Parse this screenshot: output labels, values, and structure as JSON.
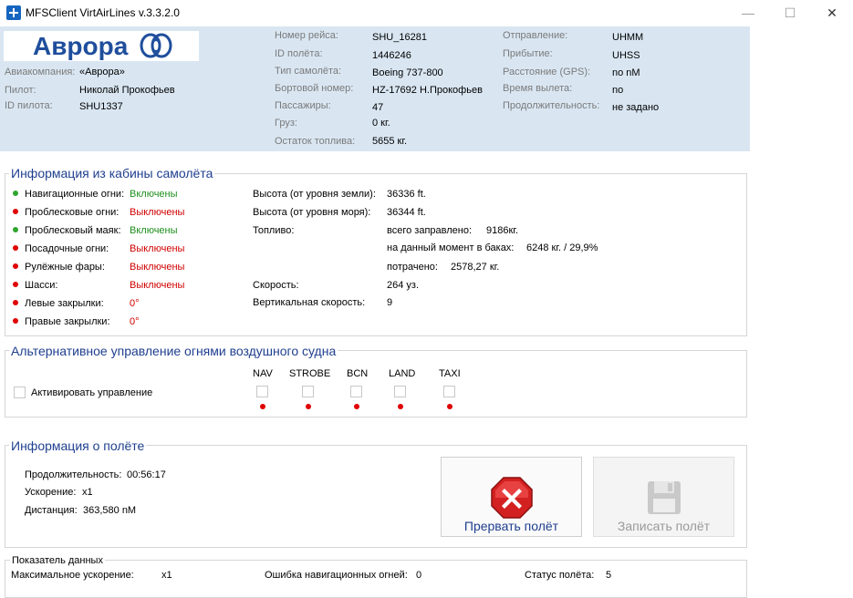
{
  "window": {
    "title": "MFSClient VirtAirLines v.3.3.2.0",
    "minimize_glyph": "—",
    "maximize_glyph": "☐",
    "close_glyph": "✕",
    "icon": "airplane-app-icon"
  },
  "header": {
    "logo_text": "Аврора",
    "left": [
      {
        "label": "Авиакомпания:",
        "value": "«Аврора»"
      },
      {
        "label": "Пилот:",
        "value": "Николай Прокофьев"
      },
      {
        "label": "ID пилота:",
        "value": "SHU1337"
      }
    ],
    "middle": [
      {
        "label": "Номер рейса:",
        "value": "SHU_16281"
      },
      {
        "label": "ID полёта:",
        "value": "1446246"
      },
      {
        "label": "Тип самолёта:",
        "value": "Boeing 737-800"
      },
      {
        "label": "Бортовой номер:",
        "value": "HZ-17692 Н.Прокофьев"
      },
      {
        "label": "Пассажиры:",
        "value": "47"
      },
      {
        "label": "Груз:",
        "value": "0 кг."
      },
      {
        "label": "Остаток топлива:",
        "value": "5655 кг."
      }
    ],
    "right": [
      {
        "label": "Отправление:",
        "value": "UHMM"
      },
      {
        "label": "Прибытие:",
        "value": "UHSS"
      },
      {
        "label": "Расстояние (GPS):",
        "value": "no nM"
      },
      {
        "label": "Время вылета:",
        "value": "no"
      },
      {
        "label": "Продолжительность:",
        "value": "не задано"
      }
    ]
  },
  "cockpit": {
    "title": "Информация из кабины самолёта",
    "systems": [
      {
        "label": "Навигационные огни:",
        "value": "Включены",
        "state": "on"
      },
      {
        "label": "Проблесковые огни:",
        "value": "Выключены",
        "state": "off"
      },
      {
        "label": "Проблесковый маяк:",
        "value": "Включены",
        "state": "on"
      },
      {
        "label": "Посадочные огни:",
        "value": "Выключены",
        "state": "off"
      },
      {
        "label": "Рулёжные фары:",
        "value": "Выключены",
        "state": "off"
      },
      {
        "label": "Шасси:",
        "value": "Выключены",
        "state": "off"
      },
      {
        "label": "Левые закрылки:",
        "value": "0°",
        "state": "off"
      },
      {
        "label": "Правые закрылки:",
        "value": "0°",
        "state": "off"
      }
    ],
    "alt_ground_label": "Высота (от уровня земли):",
    "alt_ground_value": "36336 ft.",
    "alt_sea_label": "Высота (от уровня моря):",
    "alt_sea_value": "36344 ft.",
    "fuel_label": "Топливо:",
    "fuel_total_label": "всего заправлено:",
    "fuel_total_value": "9186кг.",
    "fuel_now_label": "на данный момент в баках:",
    "fuel_now_value": "6248 кг. / 29,9%",
    "fuel_used_label": "потрачено:",
    "fuel_used_value": "2578,27 кг.",
    "speed_label": "Скорость:",
    "speed_value": "264 уз.",
    "vspeed_label": "Вертикальная скорость:",
    "vspeed_value": "9"
  },
  "alt_lights": {
    "title": "Альтернативное управление огнями воздушного судна",
    "activate_label": "Активировать управление",
    "lights": [
      "NAV",
      "STROBE",
      "BCN",
      "LAND",
      "TAXI"
    ]
  },
  "flight_info": {
    "title": "Информация о полёте",
    "duration_label": "Продолжительность:",
    "duration_value": "00:56:17",
    "accel_label": "Ускорение:",
    "accel_value": "x1",
    "distance_label": "Дистанция:",
    "distance_value": "363,580 nM",
    "abort_label": "Прервать полёт",
    "save_label": "Записать полёт"
  },
  "data_indicator": {
    "title": "Показатель данных",
    "max_accel_label": "Максимальное ускорение:",
    "max_accel_value": "x1",
    "nav_error_label": "Ошибка навигационных огней:",
    "nav_error_value": "0",
    "status_label": "Статус полёта:",
    "status_value": "5"
  },
  "colors": {
    "header_bg": "#d9e6f2",
    "group_title": "#1f3f8f",
    "on": "#1d8f1d",
    "off": "#d00000",
    "logo_blue": "#1f4e9c"
  }
}
